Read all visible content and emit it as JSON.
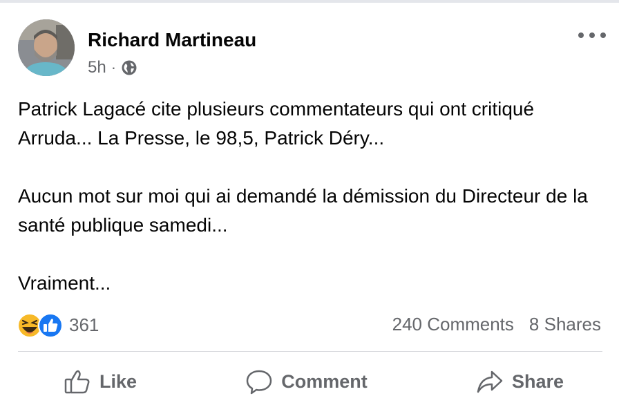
{
  "post": {
    "author": "Richard Martineau",
    "time": "5h",
    "separator": "·",
    "paragraphs": [
      "Patrick Lagacé cite plusieurs commentateurs qui ont critiqué Arruda... La Presse, le 98,5, Patrick Déry...",
      "Aucun mot sur moi qui ai demandé la démission du Directeur de la santé publique samedi...",
      "Vraiment..."
    ]
  },
  "stats": {
    "reaction_count": "361",
    "comments": "240 Comments",
    "shares": "8 Shares"
  },
  "actions": {
    "like": "Like",
    "comment": "Comment",
    "share": "Share"
  },
  "icons": [
    "globe-icon",
    "more-options-icon",
    "haha-reaction-icon",
    "like-reaction-icon",
    "like-icon",
    "comment-icon",
    "share-icon"
  ],
  "colors": {
    "like_blue": "#1877f2",
    "haha_yellow": "#f7b928",
    "secondary_text": "#65676b"
  }
}
